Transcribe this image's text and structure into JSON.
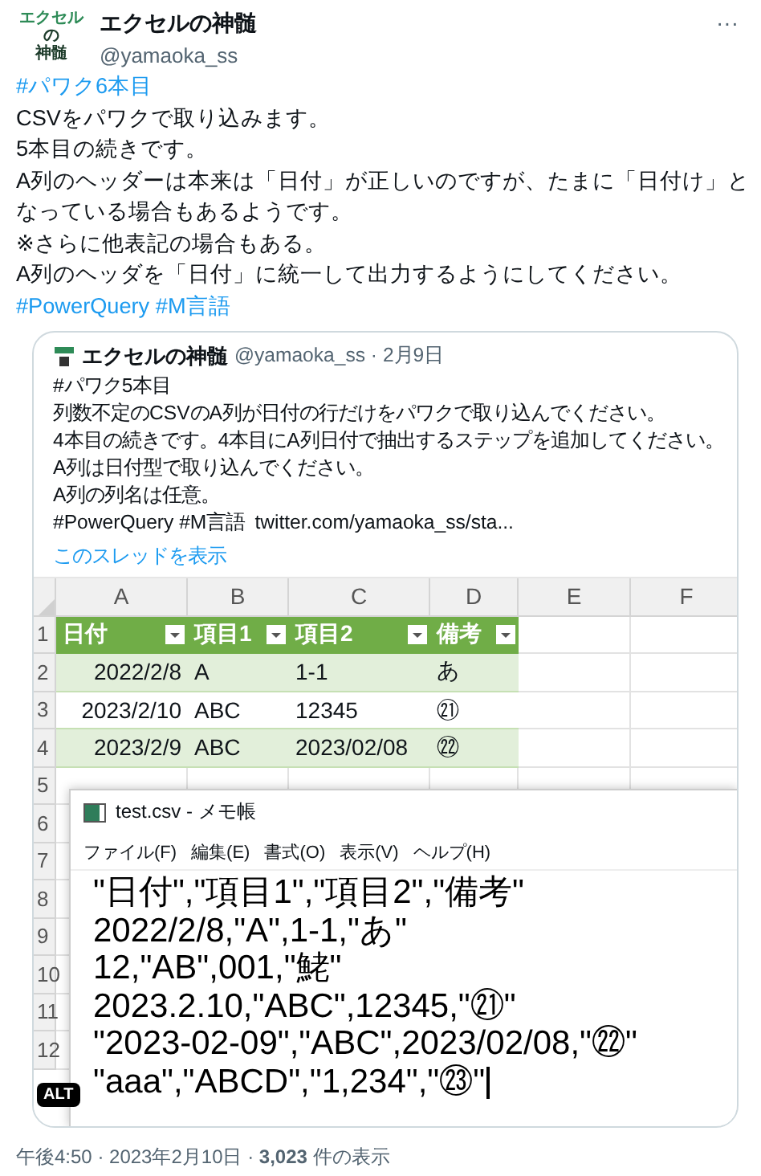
{
  "author": {
    "avatar_lines": [
      "エクセル",
      "の",
      "神髄"
    ],
    "name": "エクセルの神髄",
    "handle": "@yamaoka_ss",
    "more": "···"
  },
  "body": [
    {
      "kind": "hashtag",
      "text": "#パワク6本目"
    },
    {
      "kind": "text",
      "text": "CSVをパワクで取り込みます。"
    },
    {
      "kind": "text",
      "text": "5本目の続きです。"
    },
    {
      "kind": "text",
      "text": "A列のヘッダーは本来は「日付」が正しいのですが、たまに「日付け」と"
    },
    {
      "kind": "text",
      "text": "なっている場合もあるようです。"
    },
    {
      "kind": "text",
      "text": "※さらに他表記の場合もある。"
    },
    {
      "kind": "text",
      "text": "A列のヘッダを「日付」に統一して出力するようにしてください。"
    },
    {
      "kind": "hashtag",
      "text": "#PowerQuery #M言語"
    }
  ],
  "quote": {
    "name": "エクセルの神髄",
    "handle": "@yamaoka_ss · 2月9日",
    "lines": [
      "#パワク5本目",
      "列数不定のCSVのA列が日付の行だけをパワクで取り込んでください。",
      "4本目の続きです。4本目にA列日付で抽出するステップを追加してください。",
      "A列は日付型で取り込んでください。",
      "A列の列名は任意。"
    ],
    "tags": "#PowerQuery #M言語",
    "link": "twitter.com/yamaoka_ss/sta...",
    "show_thread": "このスレッドを表示"
  },
  "sheet": {
    "columns": [
      "A",
      "B",
      "C",
      "D",
      "E",
      "F"
    ],
    "header": {
      "number": "1",
      "cells": [
        "日付",
        "項目1",
        "項目2",
        "備考"
      ]
    },
    "rows": [
      {
        "number": "2",
        "banded": true,
        "cells": [
          "2022/2/8",
          "A",
          "1-1",
          "あ"
        ]
      },
      {
        "number": "3",
        "banded": false,
        "cells": [
          "2023/2/10",
          "ABC",
          "12345",
          "㉑"
        ]
      },
      {
        "number": "4",
        "banded": true,
        "cells": [
          "2023/2/9",
          "ABC",
          "2023/02/08",
          "㉒"
        ]
      }
    ],
    "empty_rows": [
      "5",
      "6",
      "7",
      "8",
      "9",
      "10",
      "11",
      "12"
    ]
  },
  "notepad": {
    "title": "test.csv - メモ帳",
    "menu": [
      "ファイル(F)",
      "編集(E)",
      "書式(O)",
      "表示(V)",
      "ヘルプ(H)"
    ],
    "lines": [
      "\"日付\",\"項目1\",\"項目2\",\"備考\"",
      "2022/2/8,\"A\",1-1,\"あ\"",
      "12,\"AB\",001,\"鮱\"",
      "2023.2.10,\"ABC\",12345,\"㉑\"",
      "\"2023-02-09\",\"ABC\",2023/02/08,\"㉒\"",
      "\"aaa\",\"ABCD\",\"1,234\",\"㉓\""
    ]
  },
  "alt_badge": "ALT",
  "footer": "午後4:50 · 2023年2月10日 · **3,023** 件の表示"
}
